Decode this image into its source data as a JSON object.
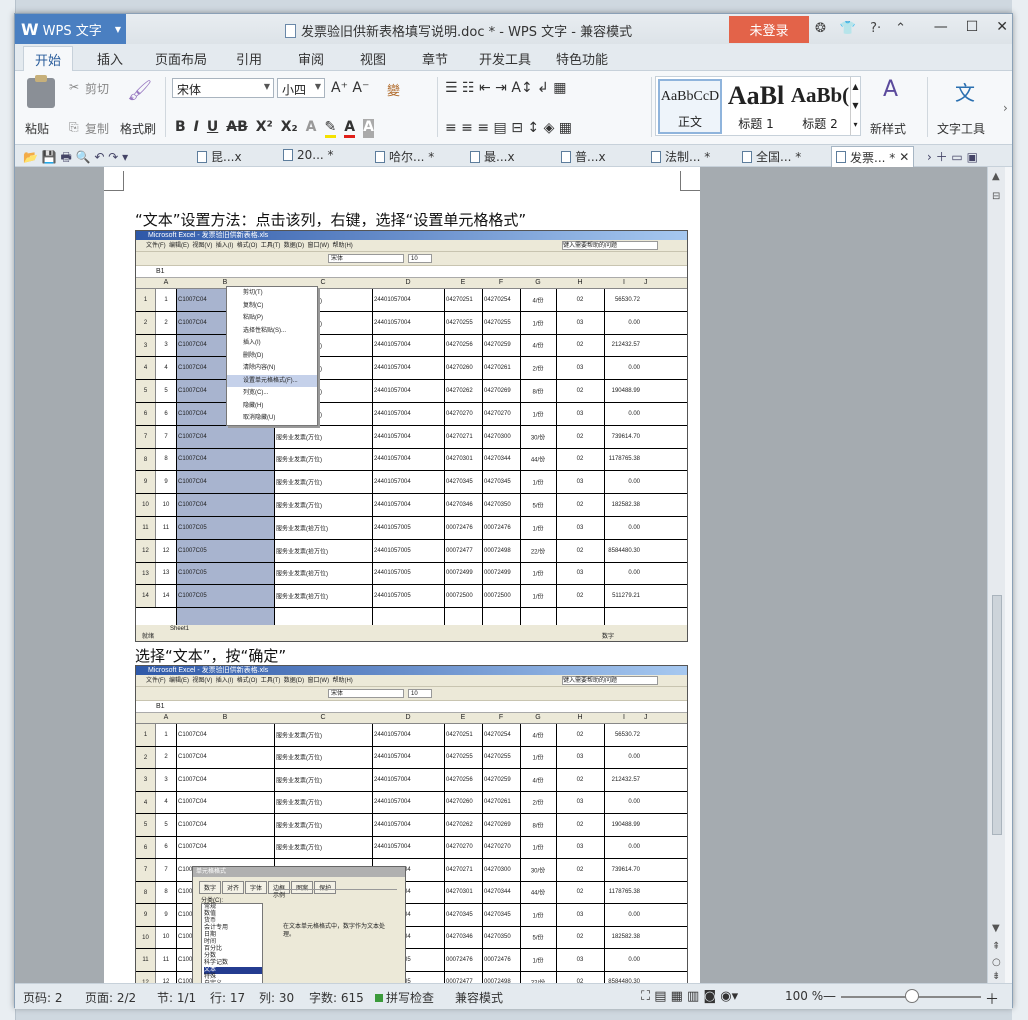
{
  "app": {
    "name": "WPS 文字",
    "doc_title": "发票验旧供新表格填写说明.doc * - WPS 文字 - 兼容模式",
    "login": "未登录",
    "title_icons": [
      "❂",
      "👕",
      "?·",
      "⌃"
    ]
  },
  "menu_tabs": [
    "开始",
    "插入",
    "页面布局",
    "引用",
    "审阅",
    "视图",
    "章节",
    "开发工具",
    "特色功能"
  ],
  "ribbon": {
    "paste": "粘贴",
    "cut": "剪切",
    "copy": "复制",
    "format_painter": "格式刷",
    "font_name": "宋体",
    "font_size": "小四",
    "styles": [
      {
        "preview": "AaBbCcD",
        "label": "正文"
      },
      {
        "preview": "AaBl",
        "label": "标题 1"
      },
      {
        "preview": "AaBb(",
        "label": "标题 2"
      }
    ],
    "new_style": "新样式",
    "text_tools": "文字工具"
  },
  "doc_tabs": [
    "昆...x",
    "20... *",
    "哈尔... *",
    "最...x",
    "普...x",
    "法制... *",
    "全国... *",
    "发票... *"
  ],
  "captions": [
    "“文本”设置方法：点击该列，右键，选择“设置单元格格式”",
    "选择“文本”，按“确定”"
  ],
  "excel": {
    "title": "Microsoft Excel - 发票验旧供新表格.xls",
    "menu": [
      "文件(F)",
      "编辑(E)",
      "视图(V)",
      "插入(I)",
      "格式(O)",
      "工具(T)",
      "数据(D)",
      "窗口(W)",
      "帮助(H)"
    ],
    "help_box": "键入需要帮助的问题",
    "font": "宋体",
    "size": "10",
    "cell_ref": "B1",
    "cols": [
      "A",
      "B",
      "C",
      "D",
      "E",
      "F",
      "G",
      "H",
      "I",
      "J"
    ],
    "rows": [
      {
        "n": "1",
        "a": "1",
        "b": "C1007C04",
        "c": "服务业发票(万位)",
        "d": "24401057004",
        "e": "04270251",
        "f": "04270254",
        "g": "4/份",
        "h": "02",
        "i": "56530.72"
      },
      {
        "n": "2",
        "a": "2",
        "b": "C1007C04",
        "c": "服务业发票(万位)",
        "d": "24401057004",
        "e": "04270255",
        "f": "04270255",
        "g": "1/份",
        "h": "03",
        "i": "0.00"
      },
      {
        "n": "3",
        "a": "3",
        "b": "C1007C04",
        "c": "服务业发票(万位)",
        "d": "24401057004",
        "e": "04270256",
        "f": "04270259",
        "g": "4/份",
        "h": "02",
        "i": "212432.57"
      },
      {
        "n": "4",
        "a": "4",
        "b": "C1007C04",
        "c": "服务业发票(万位)",
        "d": "24401057004",
        "e": "04270260",
        "f": "04270261",
        "g": "2/份",
        "h": "03",
        "i": "0.00"
      },
      {
        "n": "5",
        "a": "5",
        "b": "C1007C04",
        "c": "服务业发票(万位)",
        "d": "24401057004",
        "e": "04270262",
        "f": "04270269",
        "g": "8/份",
        "h": "02",
        "i": "190488.99"
      },
      {
        "n": "6",
        "a": "6",
        "b": "C1007C04",
        "c": "服务业发票(万位)",
        "d": "24401057004",
        "e": "04270270",
        "f": "04270270",
        "g": "1/份",
        "h": "03",
        "i": "0.00"
      },
      {
        "n": "7",
        "a": "7",
        "b": "C1007C04",
        "c": "服务业发票(万位)",
        "d": "24401057004",
        "e": "04270271",
        "f": "04270300",
        "g": "30/份",
        "h": "02",
        "i": "739614.70"
      },
      {
        "n": "8",
        "a": "8",
        "b": "C1007C04",
        "c": "服务业发票(万位)",
        "d": "24401057004",
        "e": "04270301",
        "f": "04270344",
        "g": "44/份",
        "h": "02",
        "i": "1178765.38"
      },
      {
        "n": "9",
        "a": "9",
        "b": "C1007C04",
        "c": "服务业发票(万位)",
        "d": "24401057004",
        "e": "04270345",
        "f": "04270345",
        "g": "1/份",
        "h": "03",
        "i": "0.00"
      },
      {
        "n": "10",
        "a": "10",
        "b": "C1007C04",
        "c": "服务业发票(万位)",
        "d": "24401057004",
        "e": "04270346",
        "f": "04270350",
        "g": "5/份",
        "h": "02",
        "i": "182582.38"
      },
      {
        "n": "11",
        "a": "11",
        "b": "C1007C05",
        "c": "服务业发票(拾万位)",
        "d": "24401057005",
        "e": "00072476",
        "f": "00072476",
        "g": "1/份",
        "h": "03",
        "i": "0.00"
      },
      {
        "n": "12",
        "a": "12",
        "b": "C1007C05",
        "c": "服务业发票(拾万位)",
        "d": "24401057005",
        "e": "00072477",
        "f": "00072498",
        "g": "22/份",
        "h": "02",
        "i": "8584480.30"
      },
      {
        "n": "13",
        "a": "13",
        "b": "C1007C05",
        "c": "服务业发票(拾万位)",
        "d": "24401057005",
        "e": "00072499",
        "f": "00072499",
        "g": "1/份",
        "h": "03",
        "i": "0.00"
      },
      {
        "n": "14",
        "a": "14",
        "b": "C1007C05",
        "c": "服务业发票(拾万位)",
        "d": "24401057005",
        "e": "00072500",
        "f": "00072500",
        "g": "1/份",
        "h": "02",
        "i": "511279.21"
      }
    ],
    "ctx_menu": [
      "剪切(T)",
      "复制(C)",
      "粘贴(P)",
      "选择性粘贴(S)...",
      "插入(I)",
      "删除(D)",
      "清除内容(N)",
      "设置单元格格式(F)...",
      "列宽(C)...",
      "隐藏(H)",
      "取消隐藏(U)"
    ],
    "sheet": "Sheet1",
    "status_left": "就绪",
    "status_right": "数字",
    "dialog": {
      "title": "单元格格式",
      "tabs": [
        "数字",
        "对齐",
        "字体",
        "边框",
        "图案",
        "保护"
      ],
      "category_label": "分类(C):",
      "categories": [
        "常规",
        "数值",
        "货币",
        "会计专用",
        "日期",
        "时间",
        "百分比",
        "分数",
        "科学记数",
        "文本",
        "特殊",
        "自定义"
      ],
      "sample_label": "示例",
      "desc": "在文本单元格格式中，数字作为文本处理。"
    }
  },
  "status": {
    "page_code": "页码: 2",
    "pages": "页面: 2/2",
    "section": "节: 1/1",
    "row": "行: 17",
    "col": "列: 30",
    "words": "字数: 615",
    "spell": "拼写检查",
    "compat": "兼容模式",
    "zoom": "100 %"
  }
}
